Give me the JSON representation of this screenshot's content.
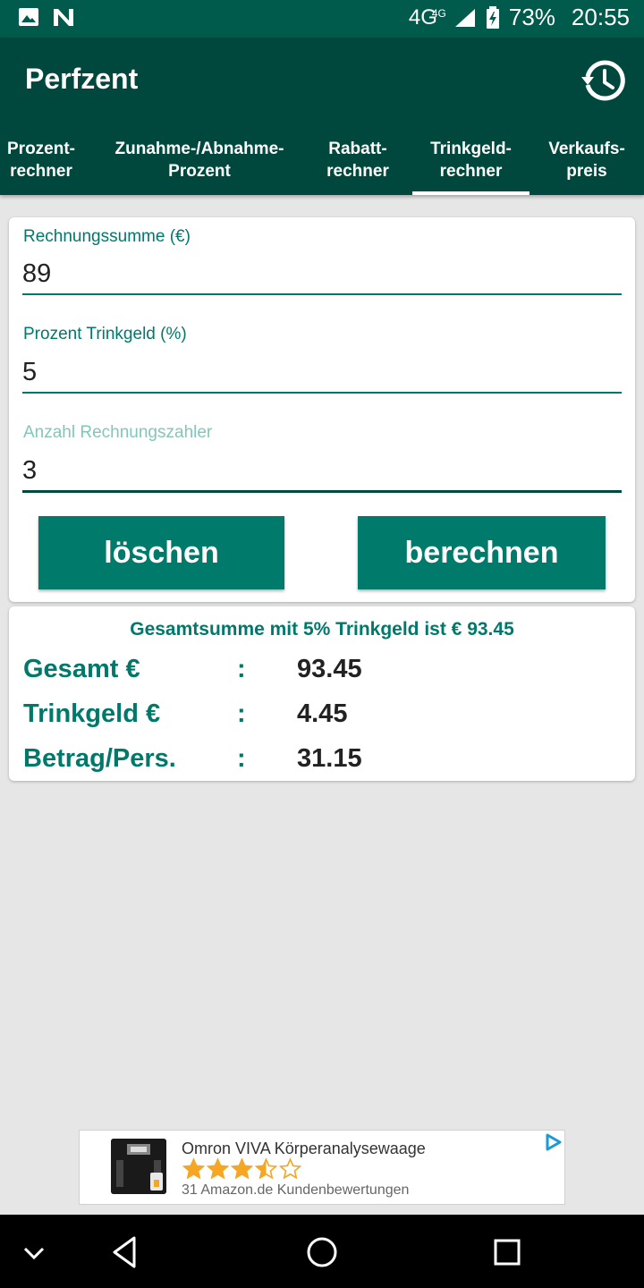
{
  "status": {
    "network": "4G",
    "network_small": "4G",
    "battery": "73%",
    "time": "20:55",
    "left_icons": [
      "image-icon",
      "notification-n-icon"
    ]
  },
  "app": {
    "title": "Perfzent",
    "history_icon": "history-icon"
  },
  "tabs": [
    {
      "label": "Prozent-\nrechner",
      "active": false
    },
    {
      "label": "Zunahme-/Abnahme-\nProzent",
      "active": false
    },
    {
      "label": "Rabatt-\nrechner",
      "active": false
    },
    {
      "label": "Trinkgeld-\nrechner",
      "active": true
    },
    {
      "label": "Verkaufs-\npreis",
      "active": false
    }
  ],
  "form": {
    "bill_label": "Rechnungssumme (€)",
    "bill_value": "89",
    "tip_label": "Prozent Trinkgeld (%)",
    "tip_value": "5",
    "payers_label": "Anzahl Rechnungszahler",
    "payers_value": "3",
    "clear_button": "löschen",
    "calc_button": "berechnen"
  },
  "result": {
    "summary": "Gesamtsumme mit 5% Trinkgeld ist € 93.45",
    "rows": [
      {
        "label": "Gesamt €",
        "colon": ":",
        "value": "93.45"
      },
      {
        "label": "Trinkgeld €",
        "colon": ":",
        "value": "4.45"
      },
      {
        "label": "Betrag/Pers.",
        "colon": ":",
        "value": "31.15"
      }
    ]
  },
  "ad": {
    "title": "Omron VIVA Körperanalysewaage",
    "rating": 3.5,
    "rating_max": 5,
    "reviews": "31 Amazon.de Kundenbewertungen",
    "star_color": "#f5a623"
  },
  "colors": {
    "primary": "#00796b",
    "app_bar": "#00473d",
    "status_bar": "#005b4c"
  }
}
